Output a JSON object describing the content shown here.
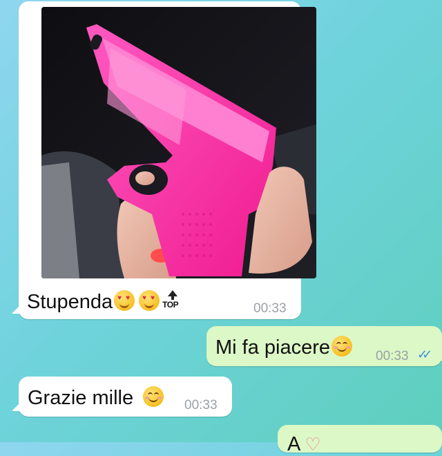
{
  "messages": [
    {
      "direction": "incoming",
      "type": "image",
      "caption": "Stupenda",
      "caption_emojis": [
        "heart-eyes-emoji",
        "heart-eyes-emoji",
        "top-icon"
      ],
      "top_icon_label": "TOP",
      "time": "00:33"
    },
    {
      "direction": "outgoing",
      "text": "Mi fa piacere",
      "emoji": "smiling-face-emoji",
      "time": "00:33",
      "status": "read"
    },
    {
      "direction": "incoming",
      "text": "Grazie mille",
      "emoji": "smiling-face-emoji",
      "time": "00:33"
    },
    {
      "direction": "outgoing",
      "text": "A",
      "emoji": "heart-emoji",
      "partial": true
    }
  ],
  "colors": {
    "incoming_bubble": "#ffffff",
    "outgoing_bubble": "#dcf8c6",
    "read_ticks": "#3f8de6",
    "timestamp": "#9aa0a6",
    "photo_case": "#ff2fa3"
  }
}
